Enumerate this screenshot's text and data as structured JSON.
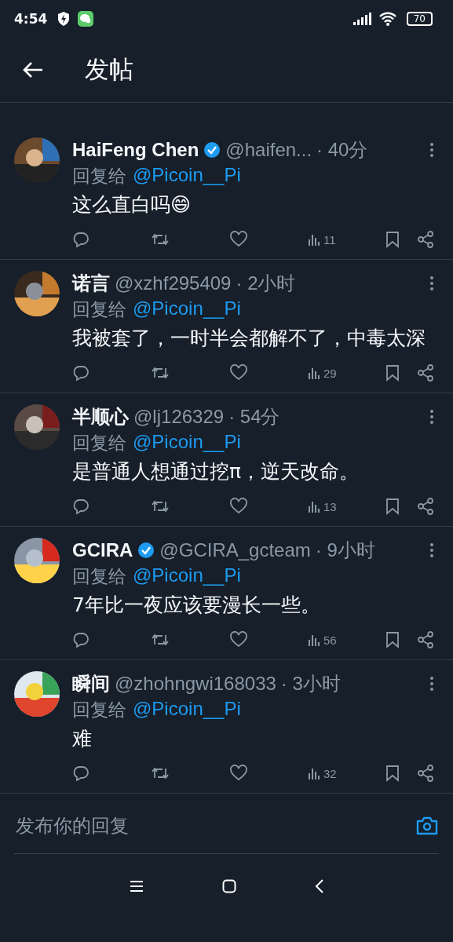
{
  "status_bar": {
    "time": "4:54",
    "battery": "70"
  },
  "header": {
    "title": "发帖"
  },
  "replies": [
    {
      "name": "HaiFeng Chen",
      "verified": true,
      "handle": "@haifen...",
      "time": "· 40分",
      "reply_to_label": "回复给",
      "reply_to": "@Picoin__Pi",
      "text": "这么直白吗😄",
      "views": "11"
    },
    {
      "name": "诺言",
      "verified": false,
      "handle": "@xzhf295409",
      "time": "· 2小时",
      "reply_to_label": "回复给",
      "reply_to": "@Picoin__Pi",
      "text": "我被套了，一时半会都解不了，中毒太深",
      "views": "29"
    },
    {
      "name": "半顺心",
      "verified": false,
      "handle": "@lj126329",
      "time": "· 54分",
      "reply_to_label": "回复给",
      "reply_to": "@Picoin__Pi",
      "text": "是普通人想通过挖π，逆天改命。",
      "views": "13"
    },
    {
      "name": "GCIRA",
      "verified": true,
      "handle": "@GCIRA_gcteam",
      "time": "· 9小时",
      "reply_to_label": "回复给",
      "reply_to": "@Picoin__Pi",
      "text": "7年比一夜应该要漫长一些。",
      "views": "56"
    },
    {
      "name": "瞬间",
      "verified": false,
      "handle": "@zhohngwi168033",
      "time": "· 3小时",
      "reply_to_label": "回复给",
      "reply_to": "@Picoin__Pi",
      "text": "难",
      "views": "32"
    }
  ],
  "composer": {
    "placeholder": "发布你的回复"
  }
}
